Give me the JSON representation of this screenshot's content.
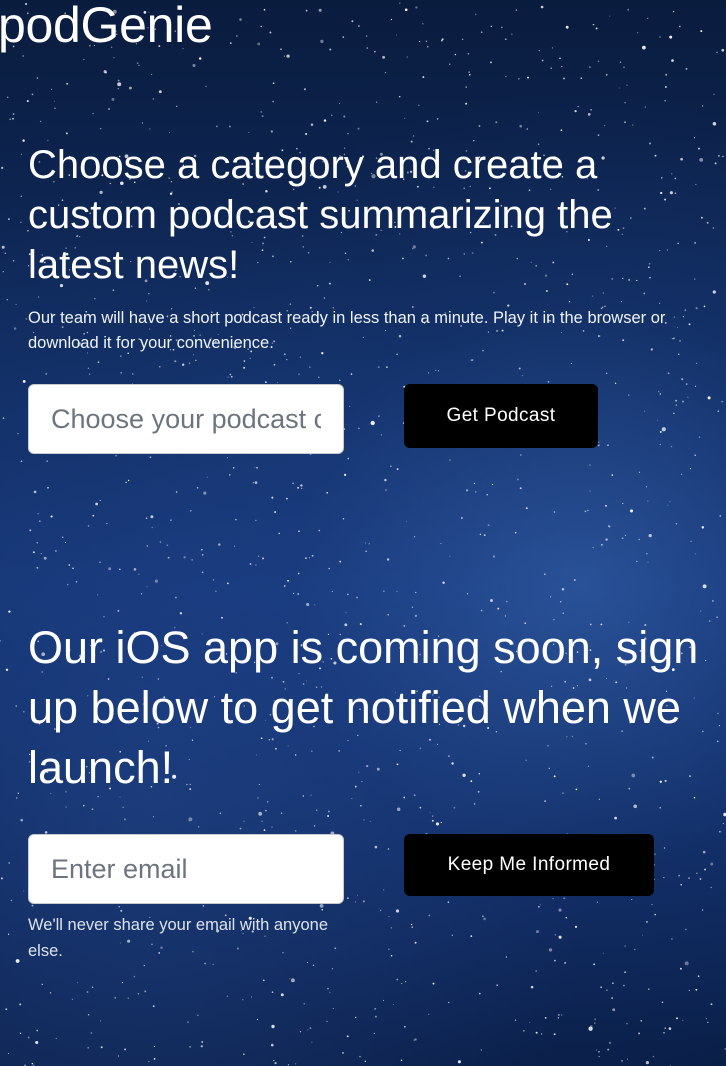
{
  "brand": {
    "name": "podGenie"
  },
  "podcast_section": {
    "heading": "Choose a category and create a custom podcast summarizing the latest news!",
    "description": "Our team will have a short podcast ready in less than a minute. Play it in the browser or download it for your convenience.",
    "category_input": {
      "value": "",
      "placeholder": "Choose your podcast category"
    },
    "submit_label": "Get Podcast"
  },
  "signup_section": {
    "heading": "Our iOS app is coming soon, sign up below to get notified when we launch!",
    "email_input": {
      "value": "",
      "placeholder": "Enter email"
    },
    "submit_label": "Keep Me Informed",
    "help_text": "We'll never share your email with anyone else."
  },
  "colors": {
    "button_background": "#000000",
    "button_text": "#ffffff",
    "background_top": "#0a1c3e",
    "background_mid": "#123270",
    "text": "#ffffff"
  }
}
